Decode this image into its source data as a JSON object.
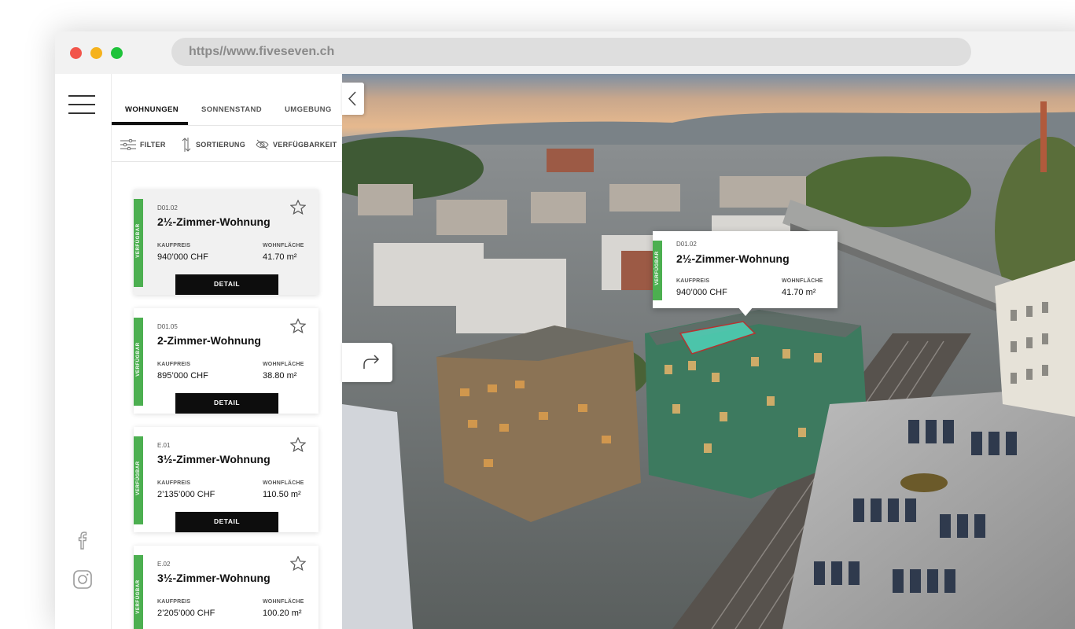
{
  "browser": {
    "url": "https//www.fiveseven.ch"
  },
  "tabs": [
    "WOHNUNGEN",
    "SONNENSTAND",
    "UMGEBUNG"
  ],
  "toolbar": {
    "filter": "FILTER",
    "sort": "SORTIERUNG",
    "availability": "VERFÜGBARKEIT"
  },
  "labels": {
    "available": "VERFÜGBAR",
    "price": "KAUFPREIS",
    "area": "WOHNFLÄCHE",
    "detail": "DETAIL"
  },
  "units": [
    {
      "code": "D01.02",
      "title": "2½-Zimmer-Wohnung",
      "price": "940’000 CHF",
      "area": "41.70 m²"
    },
    {
      "code": "D01.05",
      "title": "2-Zimmer-Wohnung",
      "price": "895’000 CHF",
      "area": "38.80 m²"
    },
    {
      "code": "E.01",
      "title": "3½-Zimmer-Wohnung",
      "price": "2’135’000 CHF",
      "area": "110.50 m²"
    },
    {
      "code": "E.02",
      "title": "3½-Zimmer-Wohnung",
      "price": "2’205’000 CHF",
      "area": "100.20 m²"
    }
  ],
  "popup": {
    "code": "D01.02",
    "title": "2½-Zimmer-Wohnung",
    "price": "940’000 CHF",
    "area": "41.70 m²"
  },
  "icons": {
    "menu": "hamburger-menu-icon",
    "facebook": "facebook-icon",
    "instagram": "instagram-icon",
    "favorite": "star-icon",
    "collapse": "chevron-left-icon",
    "rotate": "rotate-icon"
  },
  "colors": {
    "available": "#4caf50",
    "accent": "#0d0d0d",
    "highlight": "#4fd1b8"
  }
}
